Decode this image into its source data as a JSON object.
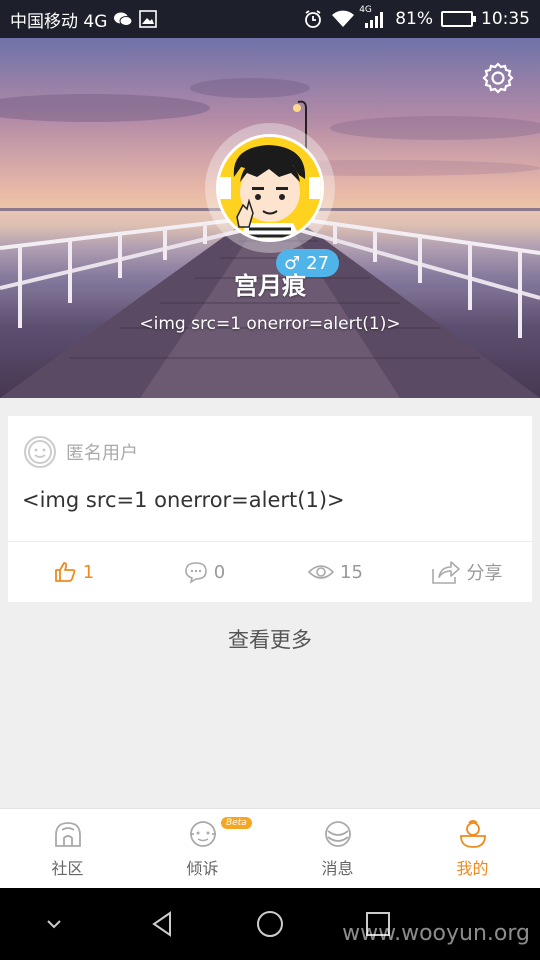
{
  "status_bar": {
    "carrier": "中国移动 4G",
    "signal_label": "4G",
    "battery_percent": "81%",
    "battery_level": 0.81,
    "time": "10:35"
  },
  "profile": {
    "name": "宫月痕",
    "bio": "<img src=1 onerror=alert(1)>",
    "gender_symbol": "♂",
    "age": "27"
  },
  "post": {
    "author": "匿名用户",
    "text": "<img src=1 onerror=alert(1)>",
    "likes": "1",
    "comments": "0",
    "views": "15",
    "share_label": "分享"
  },
  "see_more": "查看更多",
  "tabs": [
    {
      "label": "社区",
      "icon": "home-icon",
      "active": false
    },
    {
      "label": "倾诉",
      "icon": "face-icon",
      "active": false,
      "badge": "Beta"
    },
    {
      "label": "消息",
      "icon": "message-icon",
      "active": false
    },
    {
      "label": "我的",
      "icon": "profile-icon",
      "active": true
    }
  ],
  "watermark": "www.wooyun.org",
  "colors": {
    "accent": "#f08a1d",
    "badge_blue": "#4fb4e9",
    "status_bar": "#1d1f2a"
  }
}
